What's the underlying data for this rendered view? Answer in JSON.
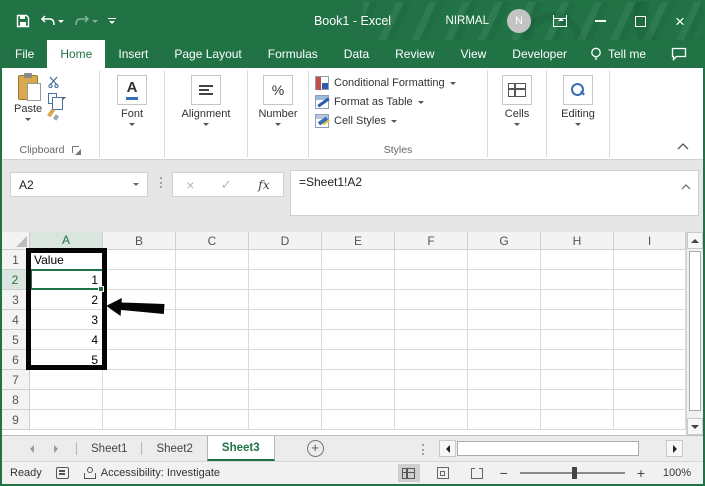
{
  "titlebar": {
    "title": "Book1 - Excel",
    "user": "NIRMAL",
    "avatar_initial": "N"
  },
  "ribbon_tabs": [
    {
      "label": "File"
    },
    {
      "label": "Home"
    },
    {
      "label": "Insert"
    },
    {
      "label": "Page Layout"
    },
    {
      "label": "Formulas"
    },
    {
      "label": "Data"
    },
    {
      "label": "Review"
    },
    {
      "label": "View"
    },
    {
      "label": "Developer"
    },
    {
      "label": "Tell me"
    }
  ],
  "active_tab": "Home",
  "ribbon": {
    "clipboard": {
      "paste": "Paste",
      "group_label": "Clipboard"
    },
    "font": {
      "label": "Font",
      "icon_letter": "A"
    },
    "alignment": {
      "label": "Alignment"
    },
    "number": {
      "label": "Number",
      "icon": "%"
    },
    "styles": {
      "items": [
        {
          "label": "Conditional Formatting"
        },
        {
          "label": "Format as Table"
        },
        {
          "label": "Cell Styles"
        }
      ],
      "group_label": "Styles"
    },
    "cells": {
      "label": "Cells"
    },
    "editing": {
      "label": "Editing"
    }
  },
  "formula_bar": {
    "name_box": "A2",
    "formula": "=Sheet1!A2",
    "fx": "fx",
    "cancel": "×",
    "enter": "✓"
  },
  "grid": {
    "columns": [
      "A",
      "B",
      "C",
      "D",
      "E",
      "F",
      "G",
      "H",
      "I"
    ],
    "selected_column": "A",
    "selected_row": "2",
    "active_cell": "A2",
    "rows": [
      {
        "num": "1",
        "a": "Value"
      },
      {
        "num": "2",
        "a": "1"
      },
      {
        "num": "3",
        "a": "2"
      },
      {
        "num": "4",
        "a": "3"
      },
      {
        "num": "5",
        "a": "4"
      },
      {
        "num": "6",
        "a": "5"
      },
      {
        "num": "7",
        "a": ""
      },
      {
        "num": "8",
        "a": ""
      },
      {
        "num": "9",
        "a": ""
      }
    ]
  },
  "annotations": {
    "highlight_range": "A1:A6",
    "arrow_points_at": "A3"
  },
  "sheet_tabs": [
    {
      "label": "Sheet1",
      "active": false
    },
    {
      "label": "Sheet2",
      "active": false
    },
    {
      "label": "Sheet3",
      "active": true
    }
  ],
  "status_bar": {
    "ready": "Ready",
    "accessibility": "Accessibility: Investigate",
    "zoom_level": "100%"
  },
  "colors": {
    "excel_green": "#217346",
    "selection_green": "#217346",
    "annotation_black": "#000000",
    "avatar_gray": "#c3c3c3"
  },
  "icons": {
    "save": "floppy-disk",
    "undo": "curved-arrow-left",
    "redo": "curved-arrow-right",
    "customize_qat": "bar-chevron-down",
    "ribbon_display_options": "window-arrow-up",
    "minimize": "dash",
    "maximize": "square",
    "close": "x",
    "tell_me": "lightbulb",
    "comments": "speech-bubble",
    "paste": "clipboard",
    "cut": "scissors",
    "copy": "two-pages",
    "format_painter": "brush",
    "dialog_launcher": "corner-arrow",
    "name_box_dropdown": "triangle-down",
    "cancel": "x-mark",
    "enter": "check-mark",
    "insert_function": "fx",
    "select_all": "corner-triangle",
    "new_sheet": "plus-circle",
    "macro_record": "grid-dot",
    "accessibility": "person",
    "view_normal": "grid",
    "view_page_layout": "page",
    "view_page_break": "page-break",
    "zoom_out": "minus",
    "zoom_in": "plus"
  }
}
